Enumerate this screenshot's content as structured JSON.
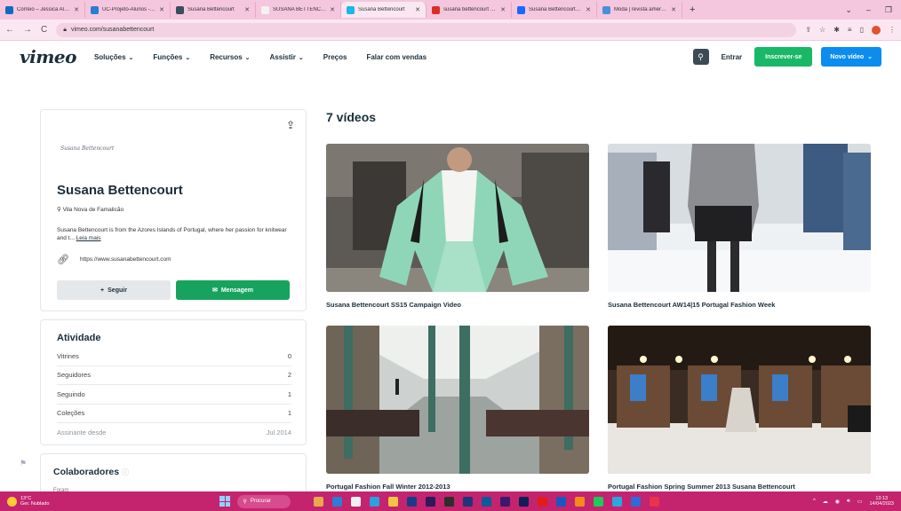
{
  "browser": {
    "tabs": [
      {
        "title": "Correio – Jéssica Almeida",
        "color": "#0f6cbd"
      },
      {
        "title": "UC-Projeto-Alunos - One",
        "color": "#2b7cd3"
      },
      {
        "title": "Susana Bettencourt",
        "color": "#3b4d5a",
        "icon_text": "HN"
      },
      {
        "title": "SUSANA BETTENCOURT",
        "color": "#f2f2f2"
      },
      {
        "title": "Susana Bettencourt",
        "color": "#1ab7ea",
        "active": true
      },
      {
        "title": "susana bettencourt - jess",
        "color": "#d93025"
      },
      {
        "title": "Susana Bettencourt on Be",
        "color": "#1769ff"
      },
      {
        "title": "Moda | revista americana",
        "color": "#4a90d9"
      }
    ],
    "url": "vimeo.com/susanabettencourt"
  },
  "vimeo": {
    "logo": "vimeo",
    "nav": [
      {
        "label": "Soluções",
        "dropdown": true
      },
      {
        "label": "Funções",
        "dropdown": true
      },
      {
        "label": "Recursos",
        "dropdown": true
      },
      {
        "label": "Assistir",
        "dropdown": true
      },
      {
        "label": "Preços",
        "dropdown": false
      },
      {
        "label": "Falar com vendas",
        "dropdown": false
      }
    ],
    "login": "Entrar",
    "signup": "Inscrever-se",
    "new_video": "Novo vídeo"
  },
  "profile": {
    "signature": "Susana Bettencourt",
    "name": "Susana Bettencourt",
    "location": "Vila Nova de Famalicão",
    "bio": "Susana Bettencourt is from the Azores Islands of Portugal, where her passion for knitwear and t...",
    "read_more": "Leia mais",
    "website": "https://www.susanabettencourt.com",
    "follow": "Seguir",
    "message": "Mensagem"
  },
  "activity": {
    "title": "Atividade",
    "rows": [
      {
        "label": "Vitrines",
        "value": "0"
      },
      {
        "label": "Seguidores",
        "value": "2"
      },
      {
        "label": "Seguindo",
        "value": "1"
      },
      {
        "label": "Coleções",
        "value": "1"
      },
      {
        "label": "Assinante desde",
        "value": "Jul 2014"
      }
    ]
  },
  "collaborators": {
    "title": "Colaboradores",
    "sub": "Foram"
  },
  "videos": {
    "count_label": "7 vídeos",
    "items": [
      {
        "title": "Susana Bettencourt SS15 Campaign Video"
      },
      {
        "title": "Susana Bettencourt AW14|15 Portugal Fashion Week"
      },
      {
        "title": "Portugal Fashion Fall Winter 2012-2013"
      },
      {
        "title": "Portugal Fashion Spring Summer 2013 Susana Bettencourt"
      }
    ]
  },
  "taskbar": {
    "temp": "13°C",
    "weather": "Ger. Nublado",
    "search": "Procurar",
    "time": "13:13",
    "date": "14/04/2023"
  }
}
